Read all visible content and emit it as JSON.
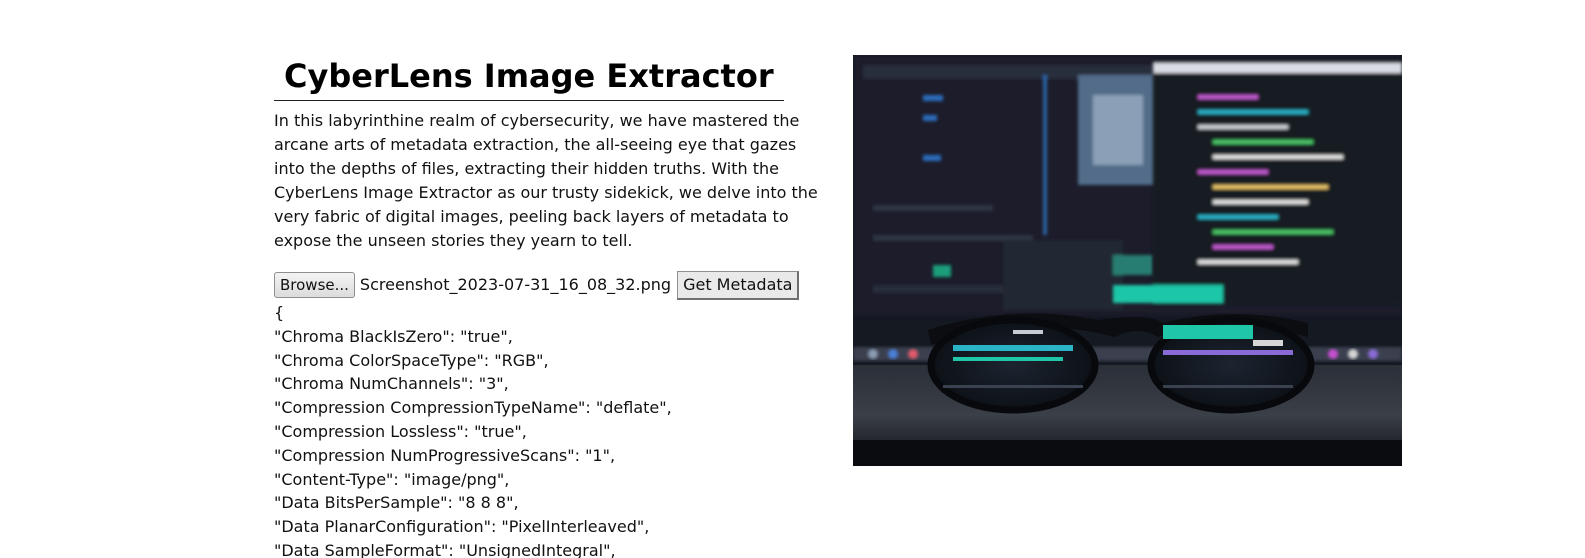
{
  "page": {
    "title": "CyberLens Image Extractor",
    "intro": "In this labyrinthine realm of cybersecurity, we have mastered the arcane arts of metadata extraction, the all-seeing eye that gazes into the depths of files, extracting their hidden truths. With the CyberLens Image Extractor as our trusty sidekick, we delve into the very fabric of digital images, peeling back layers of metadata to expose the unseen stories they yearn to tell."
  },
  "upload": {
    "browse_label": "Browse...",
    "file_name": "Screenshot_2023-07-31_16_08_32.png",
    "submit_label": "Get Metadata"
  },
  "metadata": {
    "open_brace": "{",
    "lines": [
      "\"Chroma BlackIsZero\": \"true\",",
      "\"Chroma ColorSpaceType\": \"RGB\",",
      "\"Chroma NumChannels\": \"3\",",
      "\"Compression CompressionTypeName\": \"deflate\",",
      "\"Compression Lossless\": \"true\",",
      "\"Compression NumProgressiveScans\": \"1\",",
      "\"Content-Type\": \"image/png\",",
      "\"Data BitsPerSample\": \"8 8 8\",",
      "\"Data PlanarConfiguration\": \"PixelInterleaved\",",
      "\"Data SampleFormat\": \"UnsignedIntegral\","
    ]
  },
  "hero_image": {
    "description": "photo-of-glasses-in-front-of-code-monitor"
  },
  "colors": {
    "text": "#111111",
    "background": "#ffffff",
    "button_face": "#e9e9e9"
  }
}
